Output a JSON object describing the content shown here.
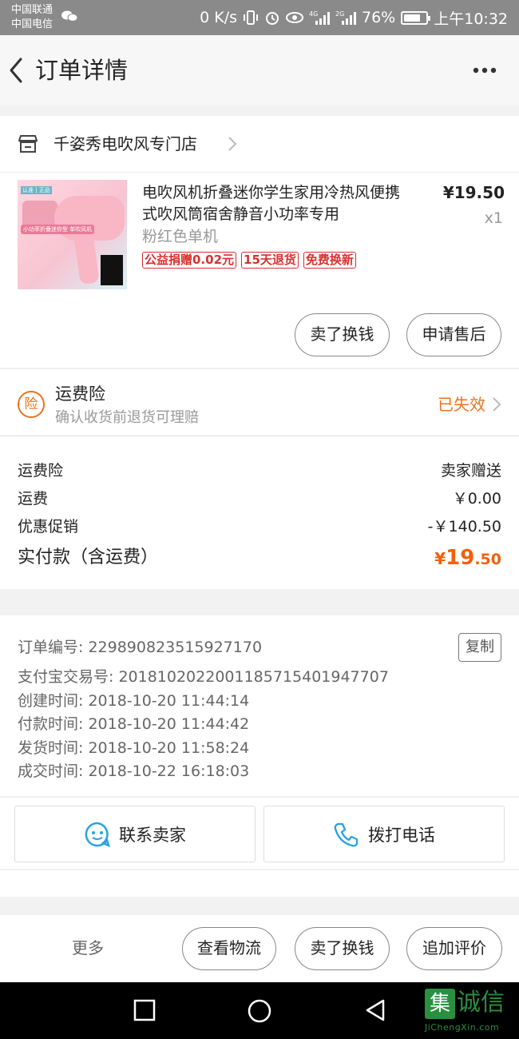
{
  "status": {
    "carrier1": "中国联通",
    "carrier2": "中国电信",
    "net_speed": "0 K/s",
    "net1": "4G",
    "net2": "2G",
    "battery": "76%",
    "battery_level": 0.76,
    "time": "上午10:32"
  },
  "nav": {
    "title": "订单详情"
  },
  "store": {
    "name": "千姿秀电吹风专门店"
  },
  "product": {
    "title": "电吹风机折叠迷你学生家用冷热风便携式吹风筒宿舍静音小功率专用",
    "sku": "粉红色单机",
    "price": "¥19.50",
    "qty": "x1",
    "badges": [
      "公益捐赠0.02元",
      "15天退货",
      "免费换新"
    ],
    "image_text": {
      "tag": "认准 | 正品",
      "caption": "小功率折叠迷你型 单吹风机"
    },
    "buttons": {
      "sell": "卖了换钱",
      "after_sale": "申请售后"
    }
  },
  "insurance": {
    "icon_text": "险",
    "title": "运费险",
    "subtitle": "确认收货前退货可理赔",
    "status": "已失效"
  },
  "summary": {
    "rows": [
      {
        "label": "运费险",
        "value": "卖家赠送"
      },
      {
        "label": "运费",
        "value": "￥0.00"
      },
      {
        "label": "优惠促销",
        "value": "-￥140.50"
      }
    ],
    "total_label": "实付款（含运费）",
    "total_currency": "¥",
    "total_int": "19",
    "total_dec": ".50"
  },
  "order_info": {
    "order_no": "订单编号: 229890823515927170",
    "alipay_no": "支付宝交易号: 2018102022001185715401947707",
    "created": "创建时间: 2018-10-20 11:44:14",
    "paid": "付款时间: 2018-10-20 11:44:42",
    "shipped": "发货时间: 2018-10-20 11:58:24",
    "completed": "成交时间: 2018-10-22 16:18:03",
    "copy_label": "复制"
  },
  "contact": {
    "seller": "联系卖家",
    "call": "拨打电话"
  },
  "bottom": {
    "more": "更多",
    "logistics": "查看物流",
    "sell": "卖了换钱",
    "review": "追加评价"
  },
  "watermark": {
    "logo": "集",
    "text": "诚信",
    "sub": "JiChengXin.com"
  }
}
